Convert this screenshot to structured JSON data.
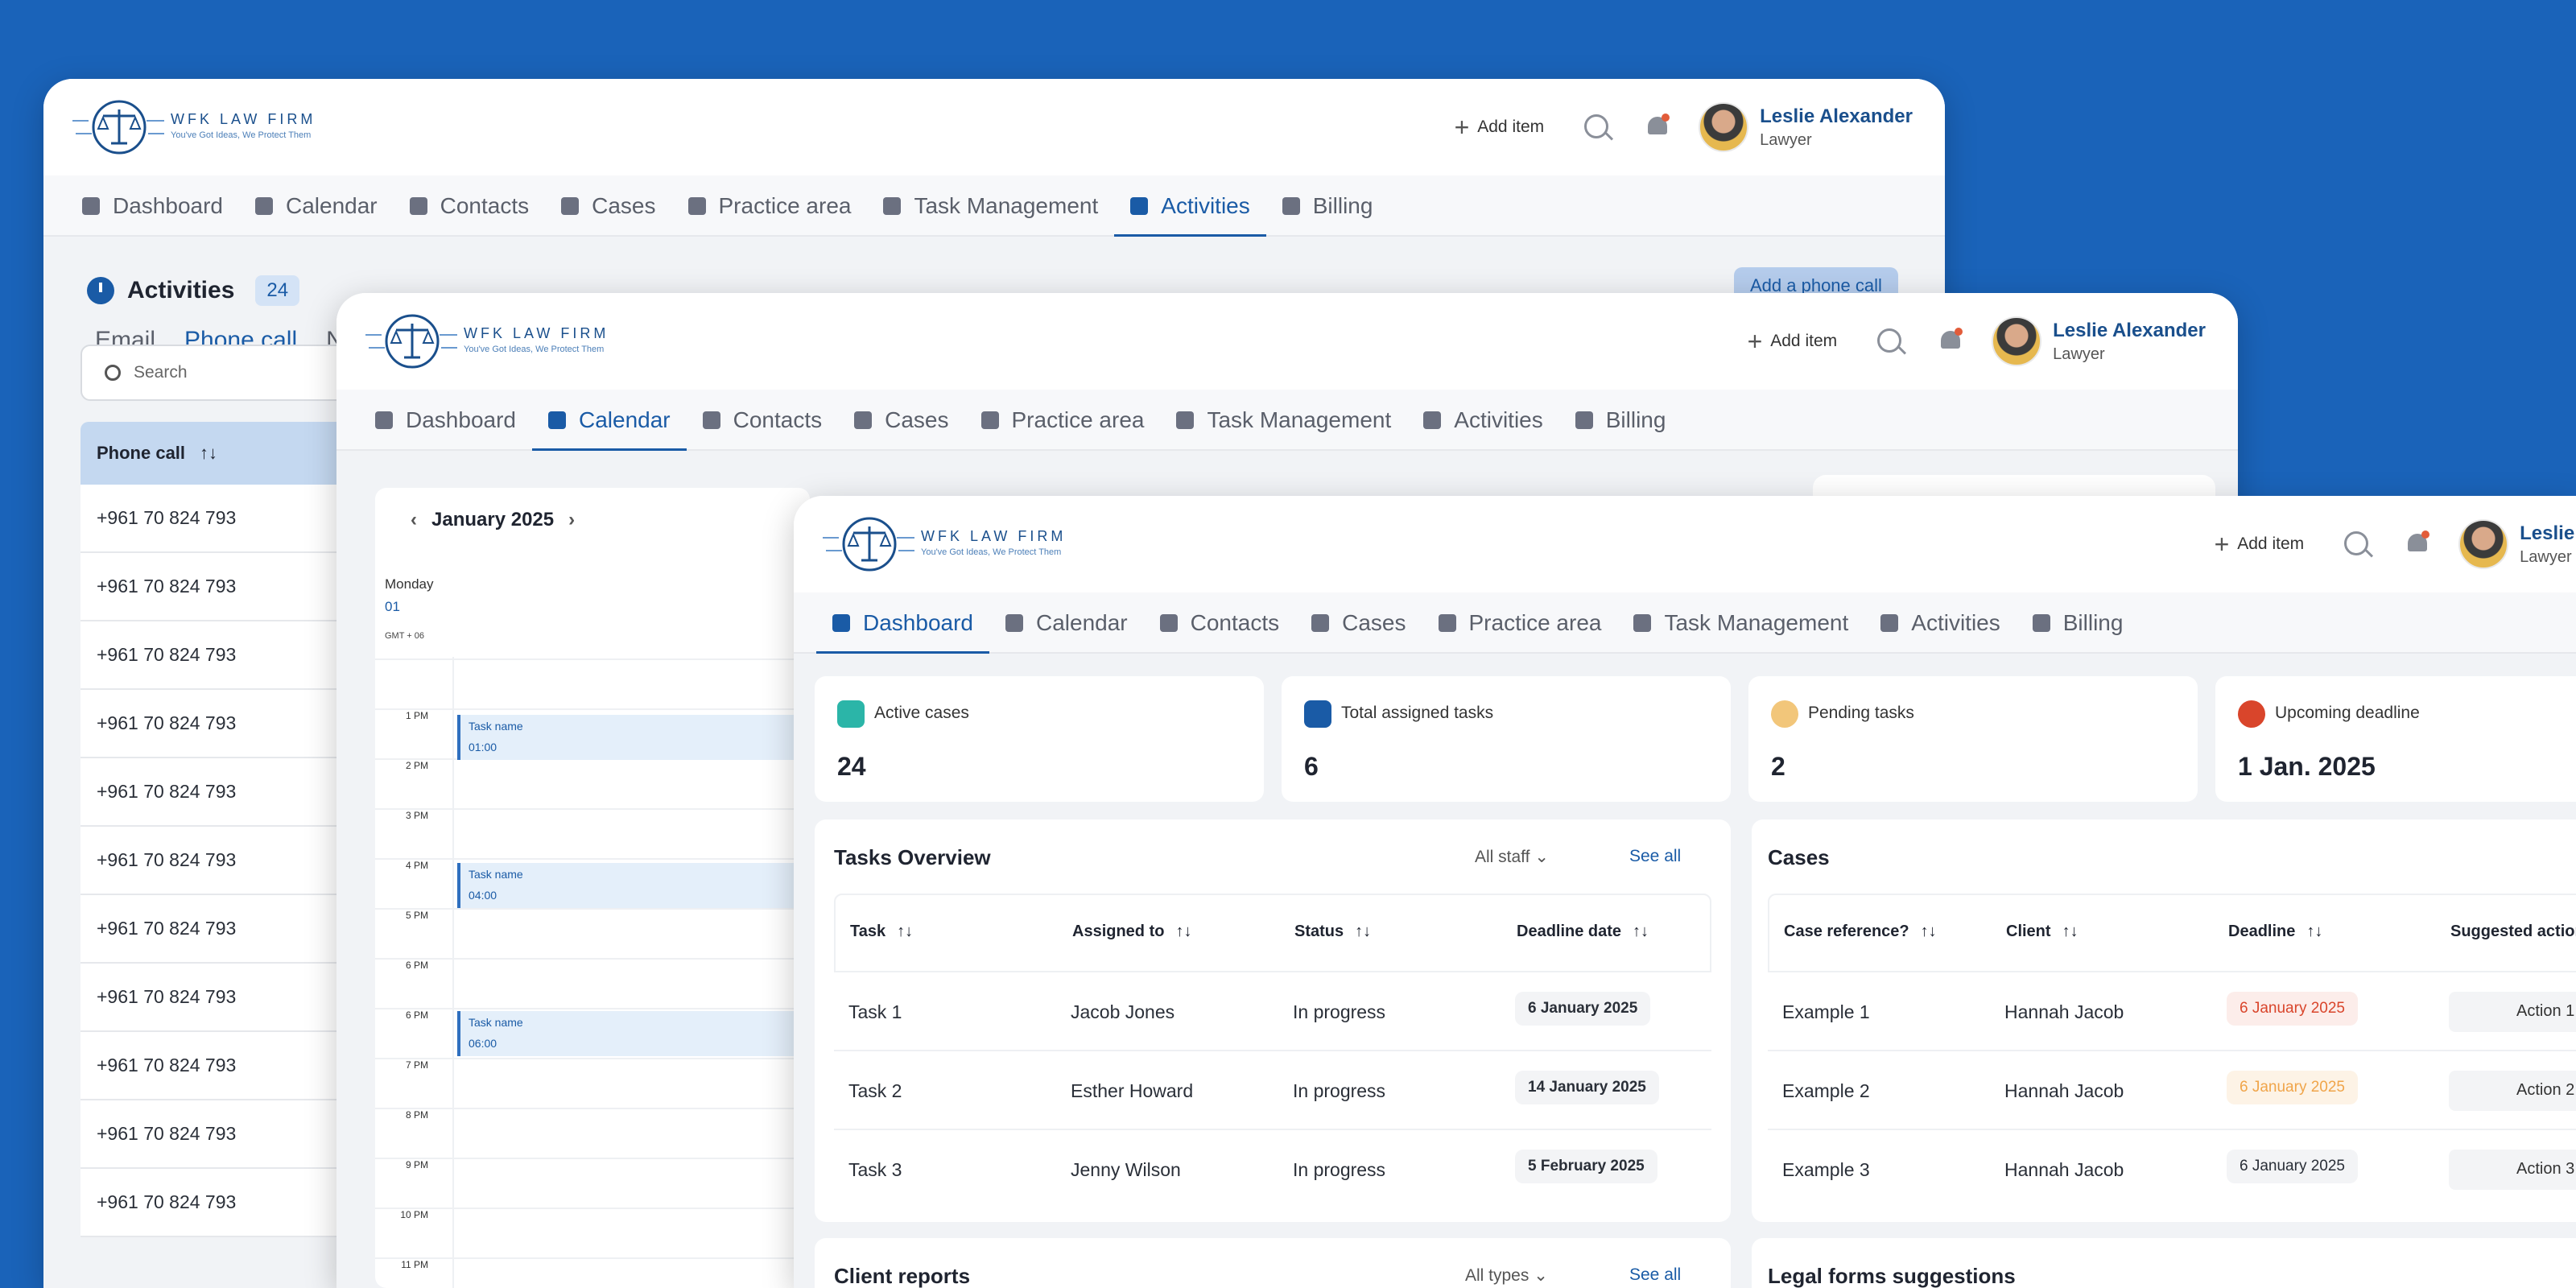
{
  "brand": {
    "name": "WFK LAW FIRM",
    "tagline": "You've Got Ideas, We Protect Them"
  },
  "header": {
    "add_item": "Add item",
    "user_name": "Leslie Alexander",
    "user_role": "Lawyer"
  },
  "nav": [
    "Dashboard",
    "Calendar",
    "Contacts",
    "Cases",
    "Practice area",
    "Task Management",
    "Activities",
    "Billing"
  ],
  "activities": {
    "title": "Activities",
    "count": "24",
    "add_button": "Add a phone call",
    "subtabs": [
      "Email",
      "Phone call",
      "N"
    ],
    "search_placeholder": "Search",
    "column": "Phone call",
    "sort_glyph": "↑↓",
    "rows": [
      "+961 70 824 793",
      "+961 70 824 793",
      "+961 70 824 793",
      "+961 70 824 793",
      "+961 70 824 793",
      "+961 70 824 793",
      "+961 70 824 793",
      "+961 70 824 793",
      "+961 70 824 793",
      "+961 70 824 793",
      "+961 70 824 793"
    ]
  },
  "calendar": {
    "month": "January 2025",
    "prev": "‹",
    "next": "›",
    "day_name": "Monday",
    "day_num": "01",
    "timezone": "GMT + 06",
    "hours": [
      "1 PM",
      "2 PM",
      "3 PM",
      "4 PM",
      "5 PM",
      "6 PM",
      "6 PM",
      "7 PM",
      "8 PM",
      "9 PM",
      "10 PM",
      "11 PM"
    ],
    "events": [
      {
        "name": "Task name",
        "time": "01:00"
      },
      {
        "name": "Task name",
        "time": "04:00"
      },
      {
        "name": "Task name",
        "time": "06:00"
      }
    ]
  },
  "dashboard": {
    "stats": [
      {
        "label": "Active cases",
        "value": "24",
        "color": "#2BB5A8"
      },
      {
        "label": "Total assigned tasks",
        "value": "6",
        "color": "#1A5BA6"
      },
      {
        "label": "Pending tasks",
        "value": "2",
        "color": "#F2C67A"
      },
      {
        "label": "Upcoming deadline",
        "value": "1 Jan. 2025",
        "color": "#D9452B"
      }
    ],
    "tasks": {
      "title": "Tasks Overview",
      "filter": "All staff",
      "see_all": "See all",
      "columns": [
        "Task",
        "Assigned to",
        "Status",
        "Deadline date"
      ],
      "rows": [
        {
          "task": "Task 1",
          "assigned": "Jacob Jones",
          "status": "In progress",
          "deadline": "6 January 2025"
        },
        {
          "task": "Task 2",
          "assigned": "Esther Howard",
          "status": "In progress",
          "deadline": "14 January 2025"
        },
        {
          "task": "Task 3",
          "assigned": "Jenny Wilson",
          "status": "In progress",
          "deadline": "5 February 2025"
        }
      ]
    },
    "cases": {
      "title": "Cases",
      "columns": [
        "Case reference?",
        "Client",
        "Deadline",
        "Suggested action"
      ],
      "rows": [
        {
          "ref": "Example 1",
          "client": "Hannah Jacob",
          "deadline": "6 January 2025",
          "action": "Action 1"
        },
        {
          "ref": "Example 2",
          "client": "Hannah Jacob",
          "deadline": "6 January 2025",
          "action": "Action 2"
        },
        {
          "ref": "Example 3",
          "client": "Hannah Jacob",
          "deadline": "6 January 2025",
          "action": "Action 3"
        }
      ]
    },
    "client_reports": {
      "title": "Client reports",
      "filter": "All types",
      "see_all": "See all"
    },
    "legal_forms": {
      "title": "Legal forms suggestions"
    }
  }
}
